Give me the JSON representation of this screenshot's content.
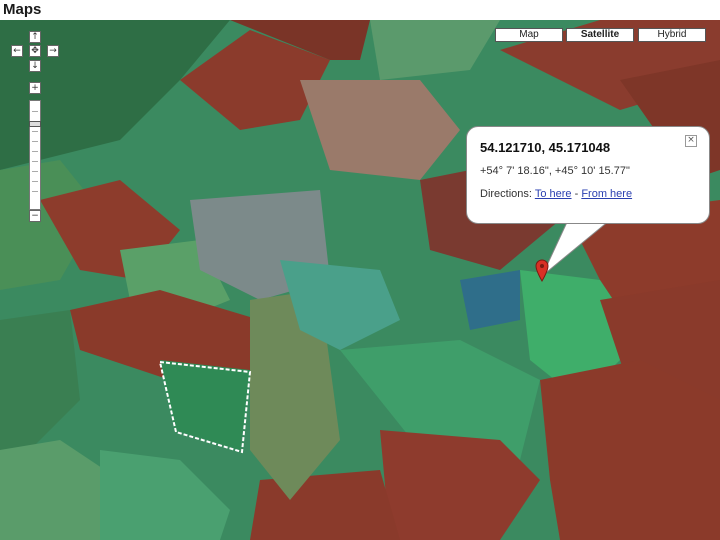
{
  "app": {
    "title": "Maps"
  },
  "controls": {
    "pan_up": "↑",
    "pan_left": "←",
    "pan_center": "✥",
    "pan_right": "→",
    "pan_down": "↓",
    "zoom_in": "+",
    "zoom_out": "−"
  },
  "map_types": [
    {
      "label": "Map",
      "active": false
    },
    {
      "label": "Satellite",
      "active": true
    },
    {
      "label": "Hybrid",
      "active": false
    }
  ],
  "info_window": {
    "coords": "54.121710, 45.171048",
    "dms": "+54° 7' 18.16\", +45° 10' 15.77\"",
    "directions_label": "Directions:",
    "to_here": "To here",
    "separator": "-",
    "from_here": "From here",
    "close": "×"
  },
  "colors": {
    "field_red": "#8e3a2a",
    "vegetation": "#3a8a5c",
    "marker": "#d93025",
    "link": "#2a3fb0"
  }
}
